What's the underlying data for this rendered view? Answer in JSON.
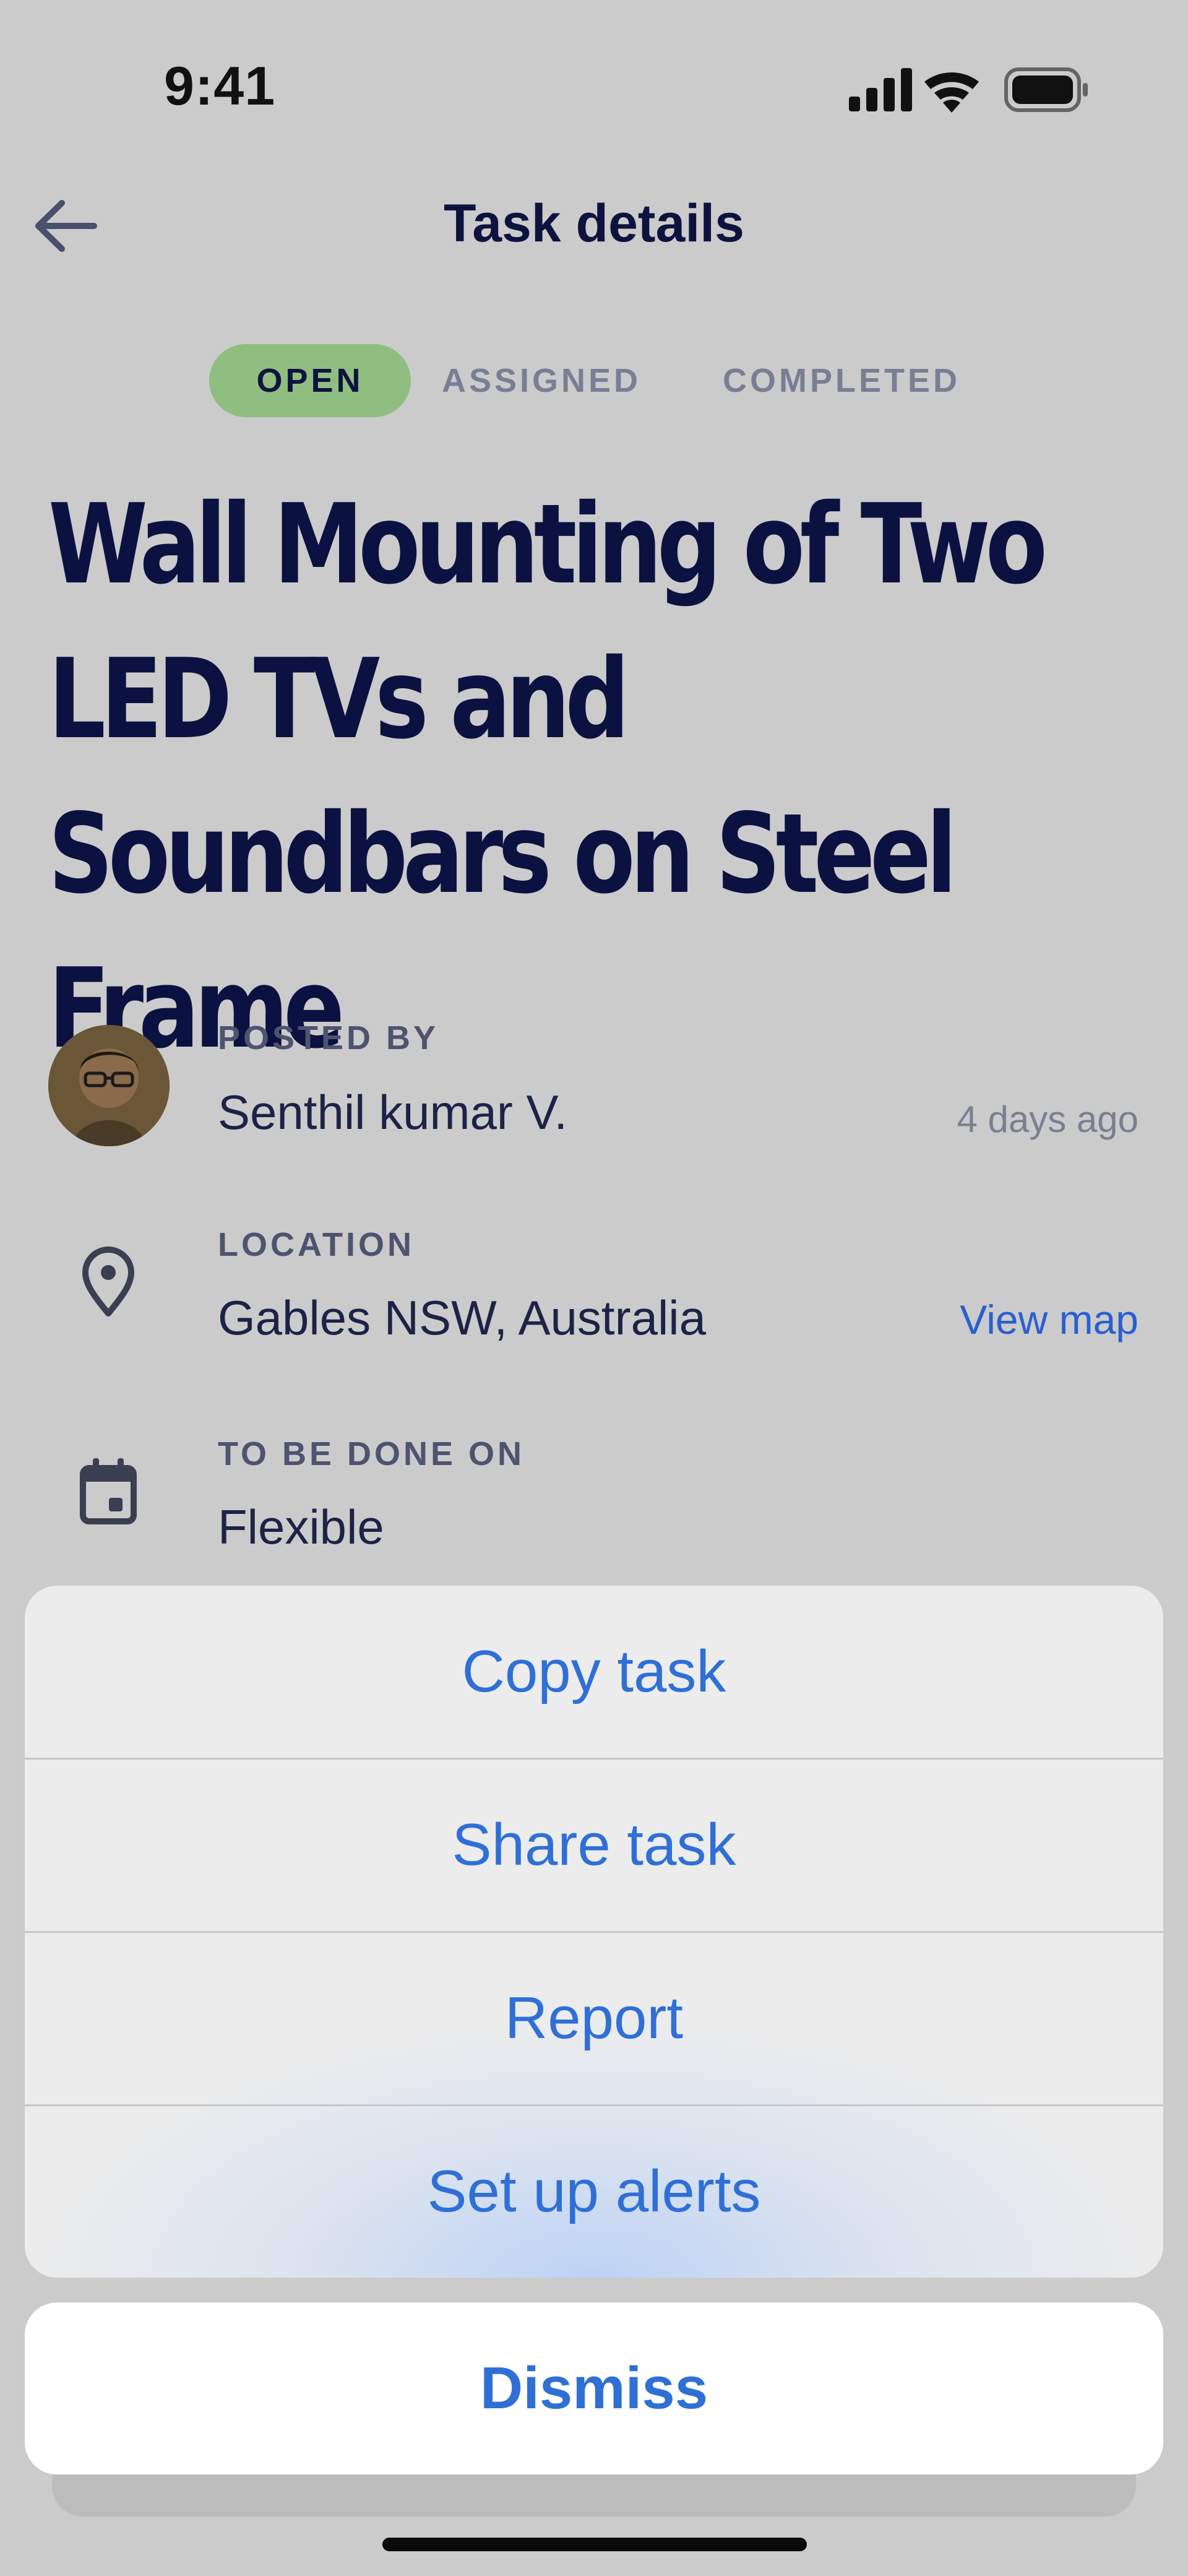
{
  "status_bar": {
    "time": "9:41"
  },
  "header": {
    "title": "Task details"
  },
  "tabs": [
    {
      "label": "OPEN",
      "active": true
    },
    {
      "label": "ASSIGNED",
      "active": false
    },
    {
      "label": "COMPLETED",
      "active": false
    }
  ],
  "task": {
    "title": "Wall Mounting of Two LED TVs and Soundbars on Steel Frame"
  },
  "posted_by": {
    "label": "POSTED BY",
    "name": "Senthil kumar V.",
    "time_ago": "4 days ago"
  },
  "location": {
    "label": "LOCATION",
    "value": "Gables NSW, Australia",
    "link": "View map"
  },
  "schedule": {
    "label": "TO BE DONE ON",
    "value": "Flexible"
  },
  "action_sheet": {
    "items": [
      "Copy task",
      "Share task",
      "Report",
      "Set up alerts"
    ],
    "dismiss": "Dismiss"
  },
  "colors": {
    "accent": "#2f6fd6",
    "tab_active": "#8fbe80",
    "title": "#0b1140",
    "backdrop": "#cbcbcb"
  },
  "icons": [
    "back-arrow-icon",
    "signal-icon",
    "wifi-icon",
    "battery-icon",
    "location-pin-icon",
    "calendar-icon"
  ]
}
